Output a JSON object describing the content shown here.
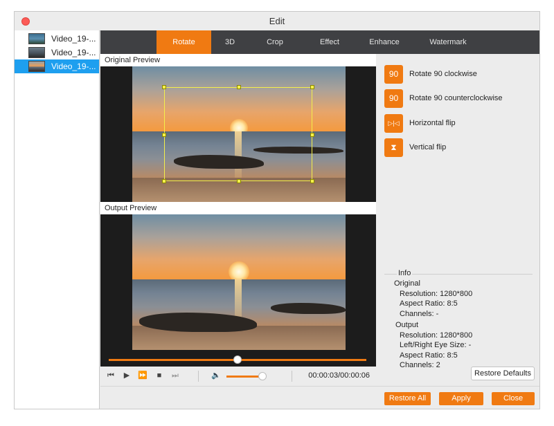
{
  "window": {
    "title": "Edit"
  },
  "files": [
    {
      "label": "Video_19-..."
    },
    {
      "label": "Video_19-..."
    },
    {
      "label": "Video_19-..."
    }
  ],
  "tabs": [
    {
      "label": "Rotate"
    },
    {
      "label": "3D"
    },
    {
      "label": "Crop"
    },
    {
      "label": "Effect"
    },
    {
      "label": "Enhance"
    },
    {
      "label": "Watermark"
    }
  ],
  "preview": {
    "original_label": "Original Preview",
    "output_label": "Output Preview"
  },
  "playback": {
    "progress": 0.5,
    "volume": 0.9,
    "timecode": "00:00:03/00:00:06"
  },
  "rotate_options": [
    {
      "label": "Rotate 90 clockwise",
      "icon": "rotate-cw-icon",
      "glyph": "90"
    },
    {
      "label": "Rotate 90 counterclockwise",
      "icon": "rotate-ccw-icon",
      "glyph": "90"
    },
    {
      "label": "Horizontal flip",
      "icon": "flip-horizontal-icon",
      "glyph": "▷|◁"
    },
    {
      "label": "Vertical flip",
      "icon": "flip-vertical-icon",
      "glyph": "⧗"
    }
  ],
  "info": {
    "title": "Info",
    "original_heading": "Original",
    "original_resolution": "Resolution: 1280*800",
    "original_aspect": "Aspect Ratio: 8:5",
    "original_channels": "Channels: -",
    "output_heading": "Output",
    "output_resolution": "Resolution: 1280*800",
    "output_eye_size": "Left/Right Eye Size: -",
    "output_aspect": "Aspect Ratio: 8:5",
    "output_channels": "Channels: 2"
  },
  "buttons": {
    "restore_defaults": "Restore Defaults",
    "restore_all": "Restore All",
    "apply": "Apply",
    "close": "Close"
  },
  "colors": {
    "accent": "#f07a12",
    "selection": "#1e9fef",
    "crop_frame": "#f5f04a"
  }
}
